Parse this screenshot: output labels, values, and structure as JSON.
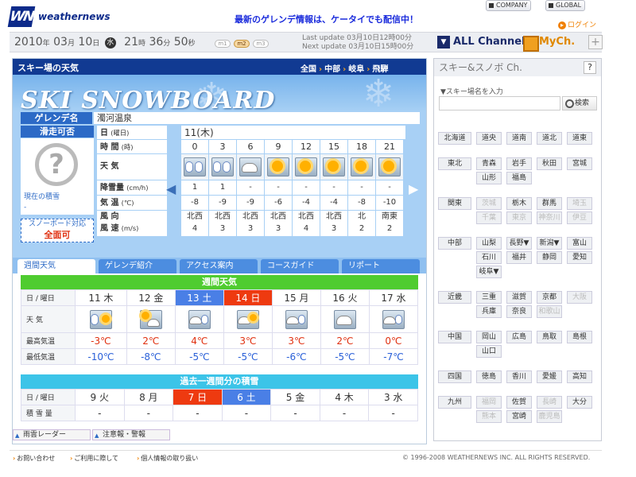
{
  "header": {
    "logo_text": "weathernews",
    "logo_mark": "WN",
    "promo": "最新のゲレンデ情報は、ケータイでも配信中！",
    "company": "COMPANY",
    "global": "GLOBAL",
    "login": "ログイン"
  },
  "datebar": {
    "year": "2010",
    "month": "03",
    "day": "10",
    "weekday": "水",
    "hour": "21",
    "minute": "36",
    "second": "50",
    "u_year": "年",
    "u_month": "月",
    "u_day": "日",
    "u_hour": "時",
    "u_min": "分",
    "u_sec": "秒",
    "sizes": [
      "m1",
      "m2",
      "m3"
    ],
    "last_update": "Last update 03月10日12時00分",
    "next_update": "Next update 03月10日15時00分",
    "all_channel": "ALL Channel",
    "mych": "MyCh.",
    "plus": "+"
  },
  "main": {
    "title": "スキー場の天気",
    "breadcrumb": [
      "全国",
      "中部",
      "岐阜",
      "飛騨"
    ],
    "hero_title": "SKI SNOWBOARD",
    "gelande_label": "ゲレンデ名",
    "gelande_name": "濁河温泉",
    "slide_label": "滑走可否",
    "slide_mark": "?",
    "snow_depth_label": "現在の積雪",
    "snow_depth_value": "-",
    "snowboard_label": "スノーボード対応",
    "snowboard_value": "全面可",
    "row_labels": {
      "date": "日",
      "date_unit": "(曜日)",
      "time": "時 間",
      "time_unit": "(時)",
      "weather": "天 気",
      "snowfall": "降雪量",
      "snowfall_unit": "(cm/h)",
      "temp": "気 温",
      "temp_unit": "(℃)",
      "wind_dir": "風 向",
      "wind_speed": "風 速",
      "wind_unit": "(m/s)"
    },
    "forecast_date": "11(木)",
    "forecast": {
      "hours": [
        "0",
        "3",
        "6",
        "9",
        "12",
        "15",
        "18",
        "21"
      ],
      "weather_icons": [
        "snow-icon",
        "snow-icon",
        "cloud-icon",
        "sun-icon",
        "sun-icon",
        "sun-icon",
        "sun-icon",
        "sun-icon"
      ],
      "snowfall": [
        "1",
        "1",
        "-",
        "-",
        "-",
        "-",
        "-",
        "-"
      ],
      "temp": [
        "-8",
        "-9",
        "-9",
        "-6",
        "-4",
        "-4",
        "-8",
        "-10"
      ],
      "wind_dir": [
        "北西",
        "北西",
        "北西",
        "北西",
        "北西",
        "北西",
        "北",
        "南東"
      ],
      "wind_speed": [
        "4",
        "3",
        "3",
        "3",
        "4",
        "3",
        "2",
        "2"
      ]
    },
    "tabs": [
      "週間天気",
      "ゲレンデ紹介",
      "アクセス案内",
      "コースガイド",
      "リポート"
    ]
  },
  "weekly": {
    "title": "週間天気",
    "date_label": "日 / 曜日",
    "weather_label": "天 気",
    "max_label": "最高気温",
    "min_label": "最低気温",
    "days": [
      {
        "date": "11 木",
        "type": "normal",
        "icon": "snow-sun-icon",
        "max": "-3℃",
        "min": "-10℃"
      },
      {
        "date": "12 金",
        "type": "normal",
        "icon": "sun-cloud-icon",
        "max": "2℃",
        "min": "-8℃"
      },
      {
        "date": "13 土",
        "type": "sat",
        "icon": "cloud-snow-icon",
        "max": "4℃",
        "min": "-5℃"
      },
      {
        "date": "14 日",
        "type": "sun",
        "icon": "cloud-sun-icon",
        "max": "3℃",
        "min": "-5℃"
      },
      {
        "date": "15 月",
        "type": "normal",
        "icon": "cloud-snow-icon",
        "max": "3℃",
        "min": "-6℃"
      },
      {
        "date": "16 火",
        "type": "normal",
        "icon": "cloud-icon",
        "max": "2℃",
        "min": "-5℃"
      },
      {
        "date": "17 水",
        "type": "normal",
        "icon": "cloud-snow-icon",
        "max": "0℃",
        "min": "-7℃"
      }
    ]
  },
  "past": {
    "title": "過去一週間分の積雪",
    "date_label": "日 / 曜日",
    "snow_label": "積 雪 量",
    "days": [
      {
        "date": "9 火",
        "type": "normal",
        "value": "-"
      },
      {
        "date": "8 月",
        "type": "normal",
        "value": "-"
      },
      {
        "date": "7 日",
        "type": "sun",
        "value": "-"
      },
      {
        "date": "6 土",
        "type": "sat",
        "value": "-"
      },
      {
        "date": "5 金",
        "type": "normal",
        "value": "-"
      },
      {
        "date": "4 木",
        "type": "normal",
        "value": "-"
      },
      {
        "date": "3 水",
        "type": "normal",
        "value": "-"
      }
    ]
  },
  "bottom_tabs": [
    "雨雲レーダー",
    "注意報・警報"
  ],
  "sidebar": {
    "title": "スキー&スノボ Ch.",
    "help": "?",
    "search_label": "▼スキー場名を入力",
    "search_placeholder": "",
    "search_button": "検索",
    "regions": [
      {
        "name": "北海道",
        "prefs": [
          {
            "n": "道央"
          },
          {
            "n": "道南"
          },
          {
            "n": "道北"
          },
          {
            "n": "道東"
          }
        ]
      },
      {
        "name": "東北",
        "prefs": [
          {
            "n": "青森"
          },
          {
            "n": "岩手"
          },
          {
            "n": "秋田"
          },
          {
            "n": "宮城"
          },
          {
            "n": "山形"
          },
          {
            "n": "福島"
          }
        ]
      },
      {
        "name": "関東",
        "prefs": [
          {
            "n": "茨城",
            "dim": true
          },
          {
            "n": "栃木"
          },
          {
            "n": "群馬"
          },
          {
            "n": "埼玉",
            "dim": true
          },
          {
            "n": "千葉",
            "dim": true
          },
          {
            "n": "東京",
            "dim": true
          },
          {
            "n": "神奈川",
            "dim": true
          },
          {
            "n": "伊豆",
            "dim": true
          }
        ]
      },
      {
        "name": "中部",
        "prefs": [
          {
            "n": "山梨"
          },
          {
            "n": "長野▼"
          },
          {
            "n": "新潟▼"
          },
          {
            "n": "富山"
          },
          {
            "n": "石川"
          },
          {
            "n": "福井"
          },
          {
            "n": "静岡"
          },
          {
            "n": "愛知"
          },
          {
            "n": "岐阜▼"
          }
        ]
      },
      {
        "name": "近畿",
        "prefs": [
          {
            "n": "三重"
          },
          {
            "n": "滋賀"
          },
          {
            "n": "京都"
          },
          {
            "n": "大阪",
            "dim": true
          },
          {
            "n": "兵庫"
          },
          {
            "n": "奈良"
          },
          {
            "n": "和歌山",
            "dim": true
          }
        ]
      },
      {
        "name": "中国",
        "prefs": [
          {
            "n": "岡山"
          },
          {
            "n": "広島"
          },
          {
            "n": "鳥取"
          },
          {
            "n": "島根"
          },
          {
            "n": "山口"
          }
        ]
      },
      {
        "name": "四国",
        "prefs": [
          {
            "n": "徳島"
          },
          {
            "n": "香川"
          },
          {
            "n": "愛媛"
          },
          {
            "n": "高知"
          }
        ]
      },
      {
        "name": "九州",
        "prefs": [
          {
            "n": "福岡",
            "dim": true
          },
          {
            "n": "佐賀"
          },
          {
            "n": "長崎",
            "dim": true
          },
          {
            "n": "大分"
          },
          {
            "n": "熊本",
            "dim": true
          },
          {
            "n": "宮崎"
          },
          {
            "n": "鹿児島",
            "dim": true
          }
        ]
      }
    ]
  },
  "footer": {
    "links": [
      "お問い合わせ",
      "ご利用に際して",
      "個人情報の取り扱い"
    ],
    "copyright": "© 1996-2008 WEATHERNEWS INC. ALL RIGHTS RESERVED."
  },
  "colors": {
    "brand": "#0c2a8a",
    "accent": "#f08000",
    "saturday": "#4a7fe6",
    "sunday": "#ee3a10"
  }
}
